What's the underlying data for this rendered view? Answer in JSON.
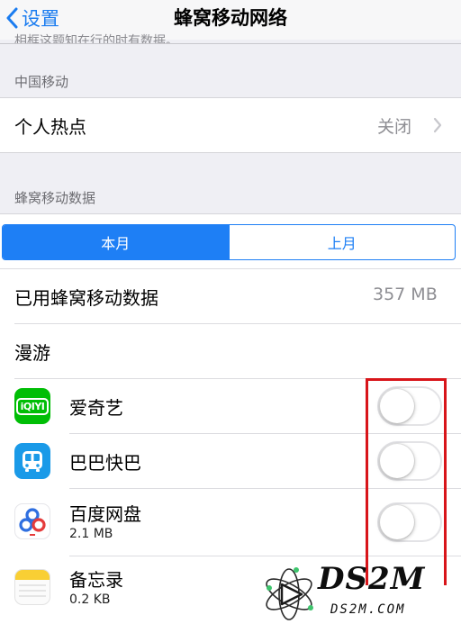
{
  "nav": {
    "back_label": "设置",
    "title": "蜂窝移动网络",
    "cutoff_text": "相框这题知在行的时有数据。"
  },
  "carrier_section": {
    "header": "中国移动",
    "hotspot": {
      "label": "个人热点",
      "value": "关闭"
    }
  },
  "data_section": {
    "header": "蜂窝移动数据",
    "segments": [
      "本月",
      "上月"
    ],
    "selected_segment": "本月",
    "used_label": "已用蜂窝移动数据",
    "used_value": "357 MB",
    "roaming_label": "漫游"
  },
  "apps": [
    {
      "name": "爱奇艺",
      "size": "",
      "toggle_on": false,
      "icon": "iqiyi-icon",
      "icon_text": "iQIYI"
    },
    {
      "name": "巴巴快巴",
      "size": "",
      "toggle_on": false,
      "icon": "bus-icon"
    },
    {
      "name": "百度网盘",
      "size": "2.1 MB",
      "toggle_on": false,
      "icon": "baidu-netdisk-icon"
    },
    {
      "name": "备忘录",
      "size": "0.2 KB",
      "toggle_on": null,
      "icon": "notes-icon"
    }
  ],
  "watermark": {
    "logo": "DS2M",
    "site": "DS2M.COM"
  },
  "colors": {
    "accent": "#1e7ff5",
    "highlight_box": "#d8151a",
    "iqiyi_green": "#00be06",
    "bus_blue": "#1a9ae8",
    "notes_yellow": "#f9cf34"
  }
}
